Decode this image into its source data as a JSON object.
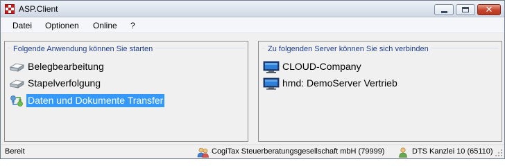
{
  "window": {
    "title": "ASP.Client"
  },
  "menu": [
    {
      "label": "Datei"
    },
    {
      "label": "Optionen"
    },
    {
      "label": "Online"
    },
    {
      "label": "?"
    }
  ],
  "left_panel": {
    "legend": "Folgende Anwendung können Sie starten",
    "items": [
      {
        "label": "Belegbearbeitung",
        "icon": "scanner-icon",
        "selected": false
      },
      {
        "label": "Stapelverfolgung",
        "icon": "scanner-icon",
        "selected": false
      },
      {
        "label": "Daten und Dokumente Transfer",
        "icon": "transfer-icon",
        "selected": true
      }
    ]
  },
  "right_panel": {
    "legend": "Zu folgenden Server können Sie sich verbinden",
    "items": [
      {
        "label": "CLOUD-Company",
        "icon": "monitor-icon"
      },
      {
        "label": "hmd: DemoServer Vertrieb",
        "icon": "monitor-icon"
      }
    ]
  },
  "statusbar": {
    "status": "Bereit",
    "company": "CogiTax Steuerberatungsgesellschaft mbH (79999)",
    "user": "DTS Kanzlei 10 (65110)"
  },
  "colors": {
    "selection": "#3399ff",
    "legend_text": "#1d3f8e"
  }
}
